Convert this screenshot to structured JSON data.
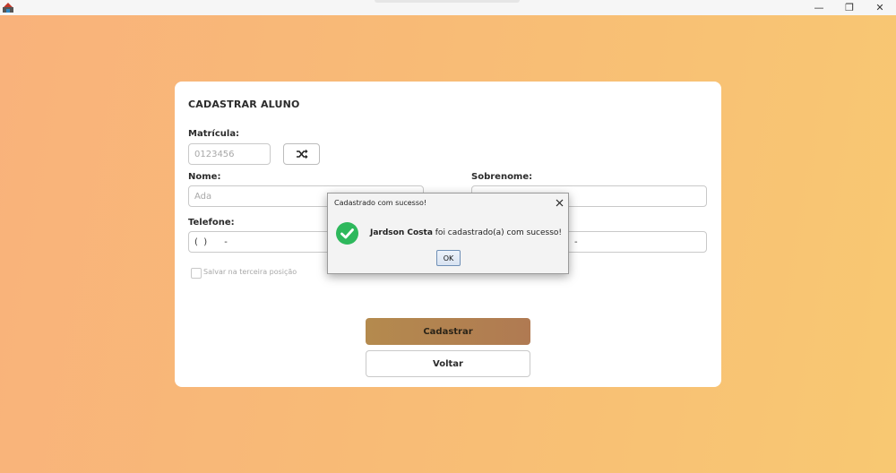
{
  "window": {
    "minimize_glyph": "—",
    "maximize_glyph": "❐",
    "close_glyph": "✕"
  },
  "form": {
    "title": "CADASTRAR ALUNO",
    "matricula_label": "Matrícula:",
    "matricula_placeholder": "0123456",
    "nome_label": "Nome:",
    "nome_placeholder": "Ada",
    "sobrenome_label": "Sobrenome:",
    "sobrenome_value": "",
    "telefone_label": "Telefone:",
    "telefone_value": "(  )      -",
    "right_field_value": "-",
    "checkbox_label": "Salvar na terceira posição",
    "checkbox_checked": false,
    "primary_button": "Cadastrar",
    "secondary_button": "Voltar"
  },
  "dialog": {
    "title": "Cadastrado com sucesso!",
    "name": "Jardson Costa",
    "message": " foi cadastrado(a) com sucesso!",
    "ok_label": "OK"
  },
  "colors": {
    "background_start": "#f9b27b",
    "background_end": "#f8c872",
    "primary_button": "#b48a4e",
    "success_icon": "#2eb85c"
  }
}
